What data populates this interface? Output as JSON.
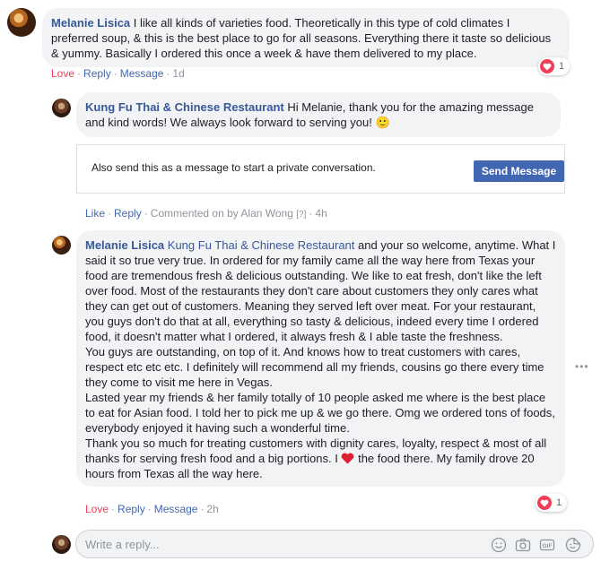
{
  "comment1": {
    "author": "Melanie Lisica",
    "text": "I like all kinds of varieties food. Theoretically in this type of cold climates I preferred soup, & this is the best place to go for all seasons. Everything there it taste so delicious & yummy. Basically I ordered this once a week & have them delivered to my place.",
    "actions": {
      "love": "Love",
      "reply": "Reply",
      "message": "Message",
      "time": "1d"
    },
    "reaction_count": "1"
  },
  "reply1": {
    "author": "Kung Fu Thai & Chinese Restaurant",
    "text": "Hi Melanie, thank you for the amazing message and kind words! We always look forward to serving you!",
    "emoji": "🙂",
    "message_prompt": {
      "text": "Also send this as a message to start a private conversation.",
      "button": "Send Message"
    },
    "actions": {
      "like": "Like",
      "reply": "Reply",
      "commented_by": "Commented on by Alan Wong",
      "qmark": "[?]",
      "time": "4h"
    }
  },
  "reply2": {
    "author": "Melanie Lisica",
    "mention": "Kung Fu Thai & Chinese Restaurant",
    "para1": "and your so welcome, anytime. What I said it so true very true. In ordered for my family came all the way here from Texas your food are tremendous fresh & delicious outstanding. We like to eat fresh, don't like the left over food. Most of the restaurants they don't care about customers they only cares what they can get out of customers. Meaning they served left over meat. For your restaurant, you guys don't do that at all, everything so tasty & delicious, indeed every time I ordered food, it doesn't matter what I ordered, it always fresh & I able taste the freshness.",
    "para2": "You guys are outstanding, on top of it. And knows how to treat customers with cares, respect etc etc etc. I definitely will recommend all my friends, cousins go there every time they come to visit me here in Vegas.",
    "para3": "Lasted year my friends & her family totally of 10 people asked me where is the best place to eat for Asian food. I told her to pick me up & we go there. Omg we ordered tons of foods, everybody enjoyed it having such a wonderful time.",
    "para4_a": "Thank you so much for treating customers with dignity cares, loyalty, respect & most of all thanks for serving fresh food and a big portions. I",
    "para4_b": "the food there. My family drove 20 hours from Texas all the way here.",
    "actions": {
      "love": "Love",
      "reply": "Reply",
      "message": "Message",
      "time": "2h"
    },
    "reaction_count": "1"
  },
  "reply_box": {
    "placeholder": "Write a reply..."
  },
  "icons": [
    "smiley-icon",
    "camera-icon",
    "gif-icon",
    "sticker-icon"
  ],
  "colors": {
    "link": "#385898",
    "love": "#f33e58",
    "button": "#4267b2",
    "bubble": "#f2f3f5"
  }
}
